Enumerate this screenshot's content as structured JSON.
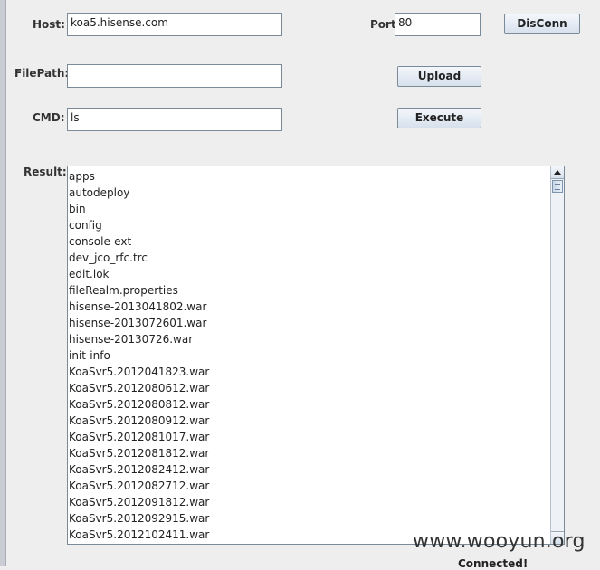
{
  "host": {
    "label": "Host:",
    "value": "koa5.hisense.com"
  },
  "port": {
    "label": "Port:",
    "value": "80"
  },
  "disconnect_button": "DisConn",
  "filepath": {
    "label": "FilePath:",
    "value": ""
  },
  "upload_button": "Upload",
  "cmd": {
    "label": "CMD:",
    "value": "ls"
  },
  "execute_button": "Execute",
  "result": {
    "label": "Result:",
    "lines": [
      "apps",
      "autodeploy",
      "bin",
      "config",
      "console-ext",
      "dev_jco_rfc.trc",
      "edit.lok",
      "fileRealm.properties",
      "hisense-2013041802.war",
      "hisense-2013072601.war",
      "hisense-20130726.war",
      "init-info",
      "KoaSvr5.2012041823.war",
      "KoaSvr5.2012080612.war",
      "KoaSvr5.2012080812.war",
      "KoaSvr5.2012080912.war",
      "KoaSvr5.2012081017.war",
      "KoaSvr5.2012081812.war",
      "KoaSvr5.2012082412.war",
      "KoaSvr5.2012082712.war",
      "KoaSvr5.2012091812.war",
      "KoaSvr5.2012092915.war",
      "KoaSvr5.2012102411.war"
    ]
  },
  "status": "Connected!",
  "watermark": "www.wooyun.org"
}
